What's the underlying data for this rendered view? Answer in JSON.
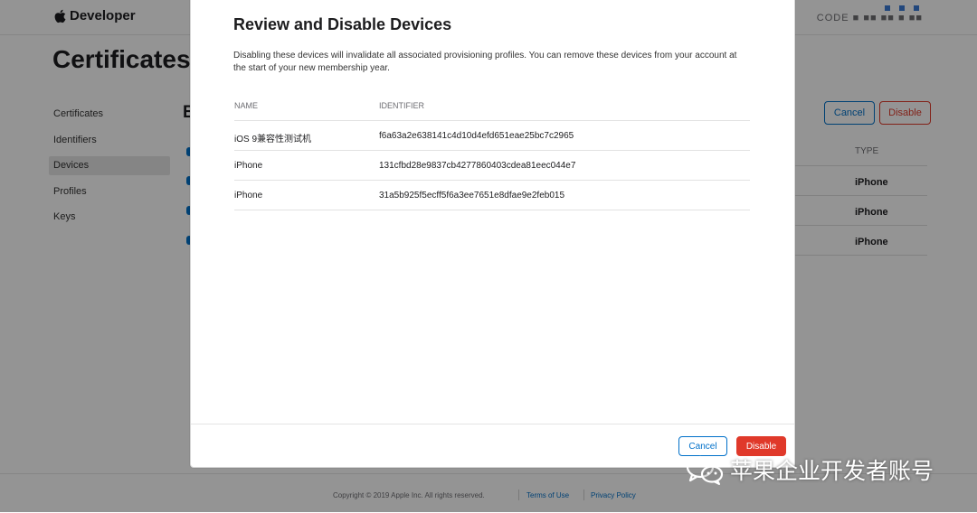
{
  "header": {
    "logo_text": "Developer",
    "account_text": "CODE ■ ■■ ■■ ■ ■■"
  },
  "page": {
    "title": "Certificates",
    "section_letter": "B"
  },
  "sidebar": {
    "items": [
      {
        "label": "Certificates",
        "active": false
      },
      {
        "label": "Identifiers",
        "active": false
      },
      {
        "label": "Devices",
        "active": true
      },
      {
        "label": "Profiles",
        "active": false
      },
      {
        "label": "Keys",
        "active": false
      }
    ]
  },
  "background_actions": {
    "cancel_label": "Cancel",
    "disable_label": "Disable"
  },
  "background_table": {
    "type_header": "TYPE",
    "types": [
      "iPhone",
      "iPhone",
      "iPhone"
    ]
  },
  "modal": {
    "title": "Review and Disable Devices",
    "description": "Disabling these devices will invalidate all associated provisioning profiles. You can remove these devices from your account at the start of your new membership year.",
    "columns": [
      "NAME",
      "IDENTIFIER"
    ],
    "rows": [
      {
        "name": "iOS 9兼容性测试机",
        "identifier": "f6a63a2e638141c4d10d4efd651eae25bc7c2965"
      },
      {
        "name": "iPhone",
        "identifier": "131cfbd28e9837cb4277860403cdea81eec044e7"
      },
      {
        "name": "iPhone",
        "identifier": "31a5b925f5ecff5f6a3ee7651e8dfae9e2feb015"
      }
    ],
    "cancel_label": "Cancel",
    "disable_label": "Disable"
  },
  "footer": {
    "copyright": "Copyright © 2019 Apple Inc. All rights reserved.",
    "terms_label": "Terms of Use",
    "privacy_label": "Privacy Policy"
  },
  "watermark": {
    "text": "苹果企业开发者账号",
    "icon": "wechat-icon"
  },
  "colors": {
    "accent": "#0070c9",
    "danger": "#e0392a",
    "overlay": "rgba(0,0,0,0.42)"
  }
}
